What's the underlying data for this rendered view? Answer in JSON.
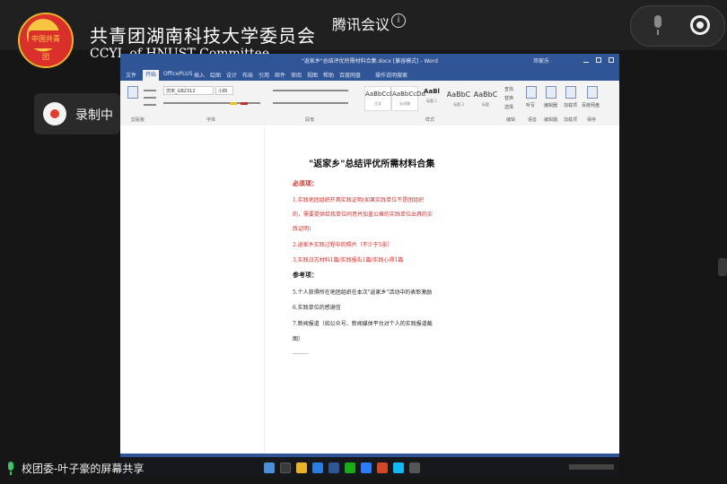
{
  "header": {
    "org_name": "共青团湖南科技大学委员会",
    "org_en": "CCYL of HNUST Committee",
    "logo_text": "中国共青团",
    "meeting_title": "腾讯会议",
    "info_icon": "i"
  },
  "recording": {
    "label": "录制中"
  },
  "window": {
    "doc_name": "\"返家乡\"总结评优所需材料合集.docx [兼容模式] - Word",
    "user": "邓家乐",
    "tabs": [
      "文件",
      "开始",
      "OfficePLUS",
      "插入",
      "绘图",
      "设计",
      "布局",
      "引用",
      "邮件",
      "审阅",
      "视图",
      "帮助",
      "百度网盘"
    ],
    "search": "操作说明搜索",
    "font_name": "仿宋_GB2312",
    "font_size": "小四",
    "styles": [
      {
        "sample": "AaBbCcDd",
        "name": "正文"
      },
      {
        "sample": "AaBbCcDd",
        "name": "无间隔"
      },
      {
        "sample": "AaBl",
        "name": "标题 1"
      },
      {
        "sample": "AaBbC",
        "name": "标题 2"
      },
      {
        "sample": "AaBbC",
        "name": "标题"
      }
    ],
    "tools": [
      "查找",
      "替换",
      "选择",
      "听写",
      "编辑器",
      "加载项",
      "百度网盘"
    ],
    "groups": [
      "剪贴板",
      "字体",
      "段落",
      "样式",
      "编辑",
      "语音",
      "编辑器",
      "加载项",
      "保存"
    ]
  },
  "document": {
    "title": "\"返家乡\"总结评优所需材料合集",
    "required_head": "必须项：",
    "req_1a": "1.实践地团组织开具实践证明(如果实践单位不是团组织",
    "req_1b": "的，需要提供给我单位同意并加盖公章的实践单位出具的实",
    "req_1c": "践证明)",
    "req_2": "2.返家乡实践过程中的照片（不少于5张）",
    "req_3": "3.实践日志材料1篇/实践报告1篇/实践心得1篇",
    "optional_head": "参考项：",
    "opt_5": "5.个人获得所在地团组织在本次\"返家乡\"活动中的表彰激励",
    "opt_6": "6.实践单位的感谢信",
    "opt_7a": "7.新闻报道（如公众号、新闻媒体平台对个人的实践报道截",
    "opt_7b": "图）"
  },
  "footer": {
    "share_label": "校团委-叶子豪的屏幕共享"
  },
  "colors": {
    "word_blue": "#2f5597",
    "doc_red": "#c6322e",
    "record_red": "#e23b2e"
  }
}
